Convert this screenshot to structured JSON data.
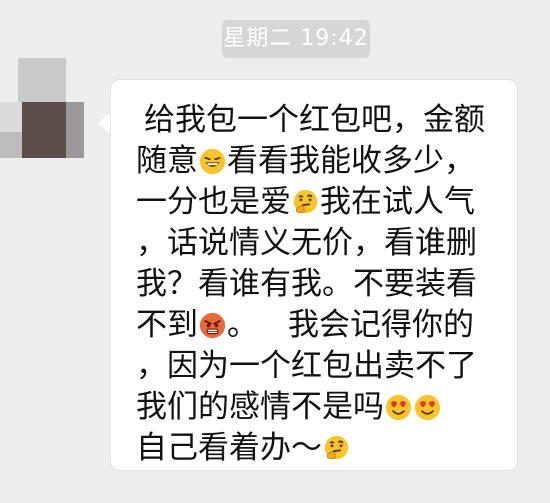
{
  "timestamp": "星期二 19:42",
  "message": {
    "l1": "给我包一个红包吧，金额",
    "l2a": "随意",
    "l2b": "看看我能收多少，",
    "l3a": "一分也是爱",
    "l3b": "我在试人气",
    "l4": "，话说情义无价，看谁删",
    "l5": "我？看谁有我。不要装看",
    "l6a": "不到",
    "l6b": "。",
    "l6c": "我会记得你的",
    "l7": "，因为一个红包出卖不了",
    "l8": "我们的感情不是吗",
    "l9": "自己看着办～"
  },
  "emojis": [
    "grinning-emoji",
    "thinking-emoji",
    "angry-emoji",
    "heart-eyes-emoji",
    "thinking-emoji"
  ],
  "colors": {
    "background": "#ededed",
    "bubble": "#ffffff",
    "timestamp_bg": "#d6d6d6",
    "text": "#111111"
  }
}
